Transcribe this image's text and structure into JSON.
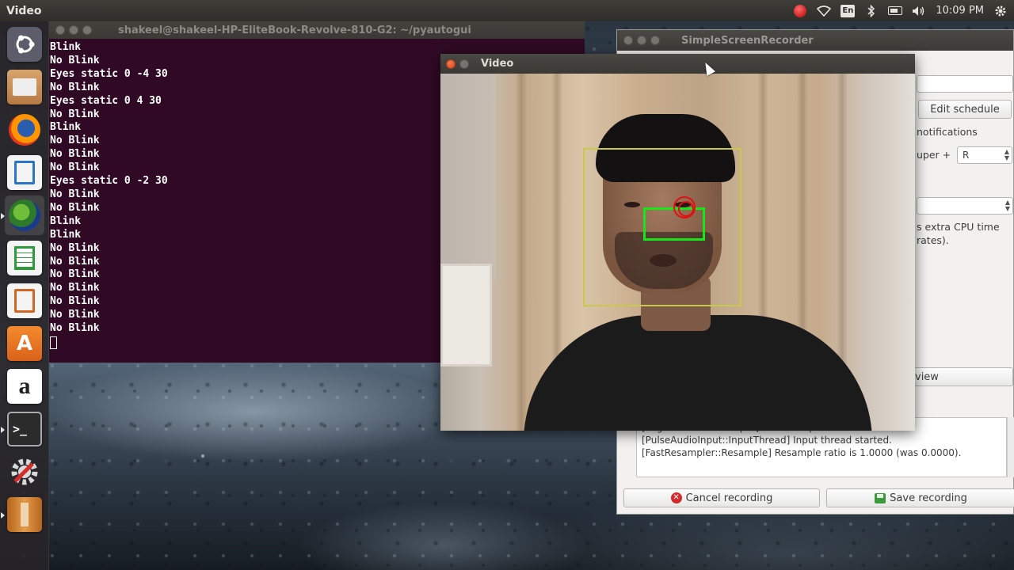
{
  "top_panel": {
    "app_name": "Video",
    "clock": "10:09 PM",
    "keyboard_layout": "En",
    "tray_icons": [
      "recording-indicator-icon",
      "wifi-icon",
      "keyboard-layout-icon",
      "bluetooth-icon",
      "battery-icon",
      "volume-icon",
      "settings-gear-icon"
    ]
  },
  "launcher": {
    "items": [
      "ubuntu-dash",
      "files",
      "firefox",
      "libreoffice-writer",
      "globe-browser",
      "libreoffice-calc",
      "libreoffice-impress",
      "ubuntu-software",
      "amazon",
      "terminal",
      "system-settings",
      "archive-manager"
    ],
    "amazon_letter": "a",
    "terminal_prompt": ">_"
  },
  "terminal": {
    "title": "shakeel@shakeel-HP-EliteBook-Revolve-810-G2: ~/pyautogui",
    "lines": [
      "Blink",
      "No Blink",
      "Eyes static 0 -4 30",
      "No Blink",
      "Eyes static 0 4 30",
      "No Blink",
      "Blink",
      "No Blink",
      "No Blink",
      "No Blink",
      "Eyes static 0 -2 30",
      "No Blink",
      "No Blink",
      "Blink",
      "Blink",
      "No Blink",
      "No Blink",
      "No Blink",
      "No Blink",
      "No Blink",
      "No Blink",
      "No Blink"
    ]
  },
  "ssr": {
    "title": "SimpleScreenRecorder",
    "edit_schedule": "Edit schedule",
    "notifications_text": "notifications",
    "hotkey_label": "uper +",
    "hotkey_value": "R",
    "cpu_text_1": "s extra CPU time",
    "cpu_text_2": "rates).",
    "preview_label": "view",
    "log_lines": [
      "[PageRecord::StartInput] Started input.",
      "[PulseAudioInput::InputThread] Input thread started.",
      "[FastResampler::Resample] Resample ratio is 1.0000 (was 0.0000)."
    ],
    "cancel_label": "Cancel recording",
    "save_label": "Save recording"
  },
  "video_window": {
    "title": "Video"
  },
  "colors": {
    "terminal_bg": "#300a24",
    "face_box": "#c8c84a",
    "eyes_box": "#19e619",
    "eye_marker": "#e01010"
  }
}
